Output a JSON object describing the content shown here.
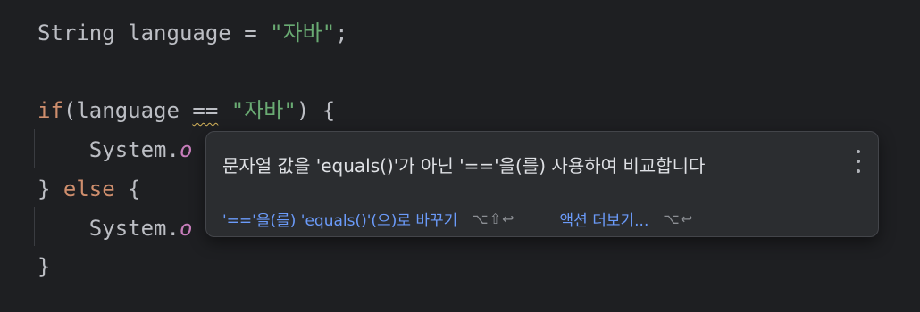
{
  "code": {
    "line1": {
      "type": "String",
      "var": " language = ",
      "str": "\"자바\"",
      "end": ";"
    },
    "line3": {
      "kw": "if",
      "pre": "(language ",
      "op": "==",
      "mid": " ",
      "str": "\"자바\"",
      "end": ") {"
    },
    "line4": {
      "indent": "    ",
      "text": "System.",
      "field": "o"
    },
    "line5": {
      "brace": "} ",
      "kw": "else",
      "end": " {"
    },
    "line6": {
      "indent": "    ",
      "text": "System.",
      "field": "o"
    },
    "line7": {
      "brace": "}"
    }
  },
  "popup": {
    "message": "문자열 값을 'equals()'가 아닌 '=='을(를) 사용하여 비교합니다",
    "menu_icon": "more-vertical-icon",
    "primary_action": "'=='을(를) 'equals()'(으)로 바꾸기",
    "primary_shortcut": "⌥⇧↩",
    "secondary_action": "액션 더보기...",
    "secondary_shortcut": "⌥↩"
  },
  "colors": {
    "background": "#1e1f22",
    "keyword": "#cf8e6d",
    "string": "#6aab73",
    "field": "#c77dbb",
    "link": "#6b9bfa",
    "warning_underline": "#d6b45a"
  }
}
